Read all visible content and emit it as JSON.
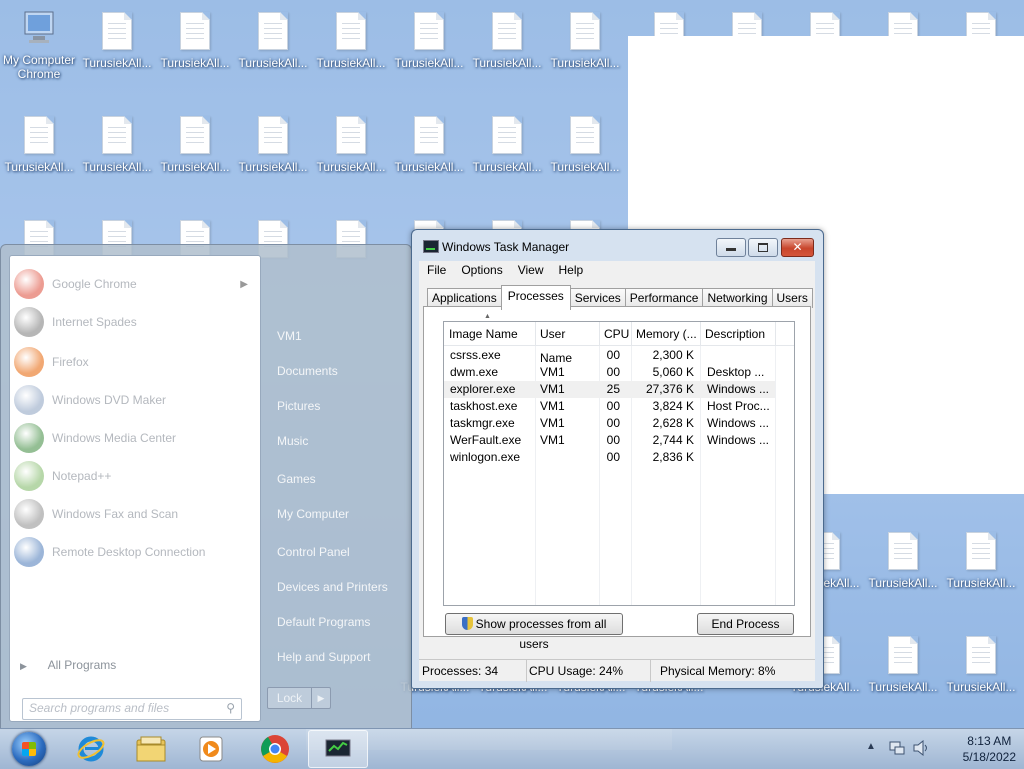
{
  "desktop": {
    "first_icon_label": [
      "My Computer",
      "Chrome"
    ],
    "icon_label": "TurusiekAll..."
  },
  "start_menu": {
    "programs": [
      {
        "label": "Google Chrome",
        "icon": "chrome-icon",
        "color": "#dd4b39",
        "has_submenu": true
      },
      {
        "label": "Internet Spades",
        "icon": "spades-icon",
        "color": "#7a7a7a",
        "has_submenu": false
      },
      {
        "label": "Firefox",
        "icon": "firefox-icon",
        "color": "#e66000",
        "has_submenu": false
      },
      {
        "label": "Windows DVD Maker",
        "icon": "dvd-maker-icon",
        "color": "#8aa0c0",
        "has_submenu": false
      },
      {
        "label": "Windows Media Center",
        "icon": "media-center-icon",
        "color": "#3c8a3c",
        "has_submenu": false
      },
      {
        "label": "Notepad++",
        "icon": "notepadpp-icon",
        "color": "#7bb662",
        "has_submenu": false
      },
      {
        "label": "Windows Fax and Scan",
        "icon": "fax-scan-icon",
        "color": "#8c8c8c",
        "has_submenu": false
      },
      {
        "label": "Remote Desktop Connection",
        "icon": "remote-desktop-icon",
        "color": "#4a79b8",
        "has_submenu": false
      }
    ],
    "all_programs": "All Programs",
    "search_placeholder": "Search programs and files",
    "right_links": [
      "VM1",
      "Documents",
      "Pictures",
      "Music",
      "Games",
      "My Computer",
      "Control Panel",
      "Devices and Printers",
      "Default Programs",
      "Help and Support"
    ],
    "lock_label": "Lock"
  },
  "task_manager": {
    "title": "Windows Task Manager",
    "close_glyph": "✕",
    "menu": [
      "File",
      "Options",
      "View",
      "Help"
    ],
    "tabs": [
      "Applications",
      "Processes",
      "Services",
      "Performance",
      "Networking",
      "Users"
    ],
    "active_tab": "Processes",
    "columns": [
      "Image Name",
      "User Name",
      "CPU",
      "Memory (...",
      "Description"
    ],
    "rows": [
      {
        "image": "csrss.exe",
        "user": "",
        "cpu": "00",
        "memory": "2,300 K",
        "description": ""
      },
      {
        "image": "dwm.exe",
        "user": "VM1",
        "cpu": "00",
        "memory": "5,060 K",
        "description": "Desktop ..."
      },
      {
        "image": "explorer.exe",
        "user": "VM1",
        "cpu": "25",
        "memory": "27,376 K",
        "description": "Windows ..."
      },
      {
        "image": "taskhost.exe",
        "user": "VM1",
        "cpu": "00",
        "memory": "3,824 K",
        "description": "Host Proc..."
      },
      {
        "image": "taskmgr.exe",
        "user": "VM1",
        "cpu": "00",
        "memory": "2,628 K",
        "description": "Windows ..."
      },
      {
        "image": "WerFault.exe",
        "user": "VM1",
        "cpu": "00",
        "memory": "2,744 K",
        "description": "Windows ..."
      },
      {
        "image": "winlogon.exe",
        "user": "",
        "cpu": "00",
        "memory": "2,836 K",
        "description": ""
      }
    ],
    "selected_row": "explorer.exe",
    "show_all_button": "Show processes from all users",
    "end_process_button": "End Process",
    "status": {
      "processes": "Processes: 34",
      "cpu": "CPU Usage: 24%",
      "memory": "Physical Memory: 8%"
    }
  },
  "taskbar": {
    "pinned": [
      "start-orb",
      "internet-explorer-icon",
      "file-explorer-icon",
      "media-player-icon",
      "chrome-icon",
      "task-manager-icon"
    ],
    "clock_time": "8:13 AM",
    "clock_date": "5/18/2022"
  }
}
